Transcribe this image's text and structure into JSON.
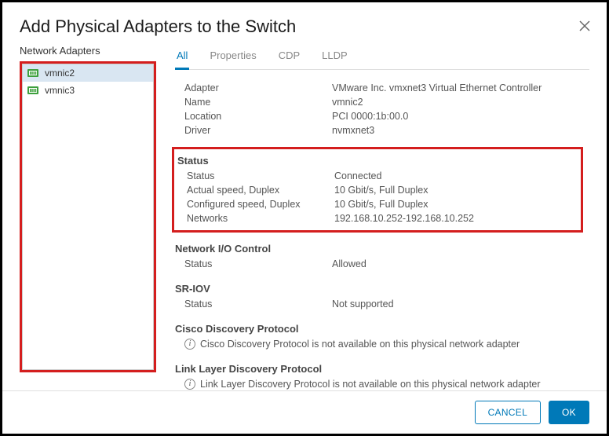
{
  "dialog": {
    "title": "Add Physical Adapters to the Switch"
  },
  "left": {
    "heading": "Network Adapters",
    "items": [
      {
        "label": "vmnic2"
      },
      {
        "label": "vmnic3"
      }
    ]
  },
  "tabs": {
    "all": "All",
    "properties": "Properties",
    "cdp": "CDP",
    "lldp": "LLDP"
  },
  "details": {
    "top": {
      "adapter_label": "Adapter",
      "adapter_value": "VMware Inc. vmxnet3 Virtual Ethernet Controller",
      "name_label": "Name",
      "name_value": "vmnic2",
      "location_label": "Location",
      "location_value": "PCI 0000:1b:00.0",
      "driver_label": "Driver",
      "driver_value": "nvmxnet3"
    },
    "status": {
      "heading": "Status",
      "status_label": "Status",
      "status_value": "Connected",
      "actual_label": "Actual speed, Duplex",
      "actual_value": "10 Gbit/s, Full Duplex",
      "configured_label": "Configured speed, Duplex",
      "configured_value": "10 Gbit/s, Full Duplex",
      "networks_label": "Networks",
      "networks_value": "192.168.10.252-192.168.10.252"
    },
    "nioc": {
      "heading": "Network I/O Control",
      "status_label": "Status",
      "status_value": "Allowed"
    },
    "sriov": {
      "heading": "SR-IOV",
      "status_label": "Status",
      "status_value": "Not supported"
    },
    "cdp": {
      "heading": "Cisco Discovery Protocol",
      "message": "Cisco Discovery Protocol is not available on this physical network adapter"
    },
    "lldp": {
      "heading": "Link Layer Discovery Protocol",
      "message": "Link Layer Discovery Protocol is not available on this physical network adapter"
    }
  },
  "footer": {
    "cancel": "CANCEL",
    "ok": "OK"
  }
}
